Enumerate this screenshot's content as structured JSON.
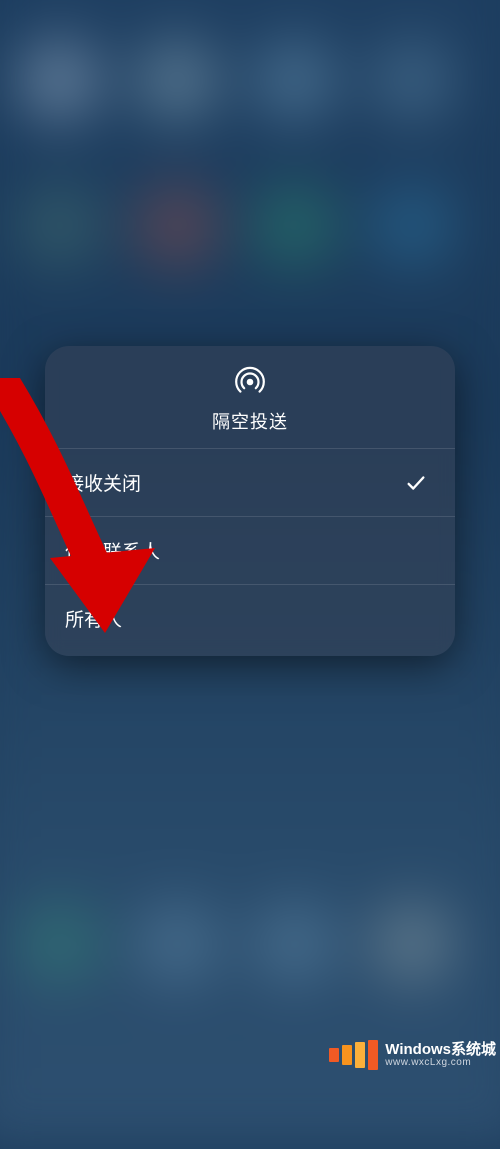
{
  "popup": {
    "title": "隔空投送",
    "options": [
      {
        "label": "接收关闭",
        "selected": true
      },
      {
        "label": "仅限联系人",
        "selected": false
      },
      {
        "label": "所有人",
        "selected": false
      }
    ]
  },
  "watermark": {
    "brand": "Windows系统城",
    "url": "www.wxcLxg.com"
  }
}
